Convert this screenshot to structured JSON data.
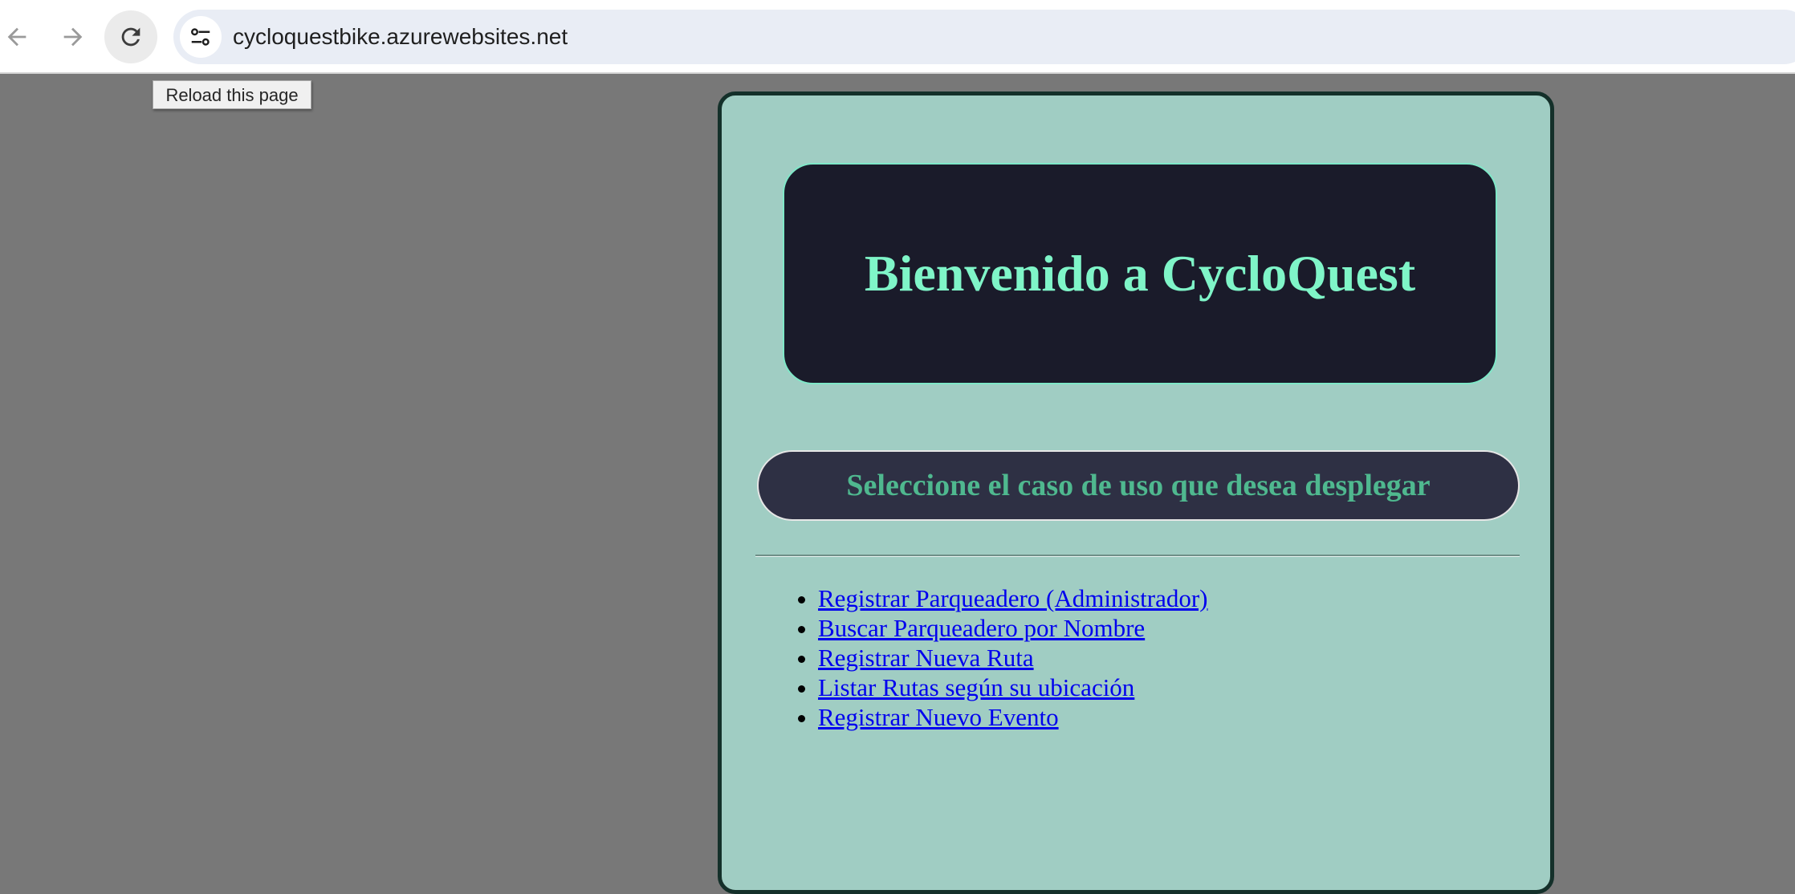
{
  "browser": {
    "url": "cycloquestbike.azurewebsites.net",
    "tooltip": "Reload this page",
    "icons": {
      "back": "arrow-left-icon",
      "forward": "arrow-right-icon",
      "reload": "reload-icon",
      "site_info": "tune-icon"
    }
  },
  "page": {
    "title": "Bienvenido a CycloQuest",
    "subtitle": "Seleccione el caso de uso que desea desplegar",
    "links": [
      "Registrar Parqueadero (Administrador)",
      "Buscar Parqueadero por Nombre",
      "Registrar Nueva Ruta",
      "Listar Rutas según su ubicación",
      "Registrar Nuevo Evento"
    ]
  },
  "colors": {
    "page_background": "#787878",
    "card_background": "#a0cdc3",
    "banner_background": "#1a1b2a",
    "title_color": "#7ff5c8",
    "pill_background": "#2e3044",
    "subtitle_color": "#4fb88f",
    "link_color": "#0000ee"
  }
}
